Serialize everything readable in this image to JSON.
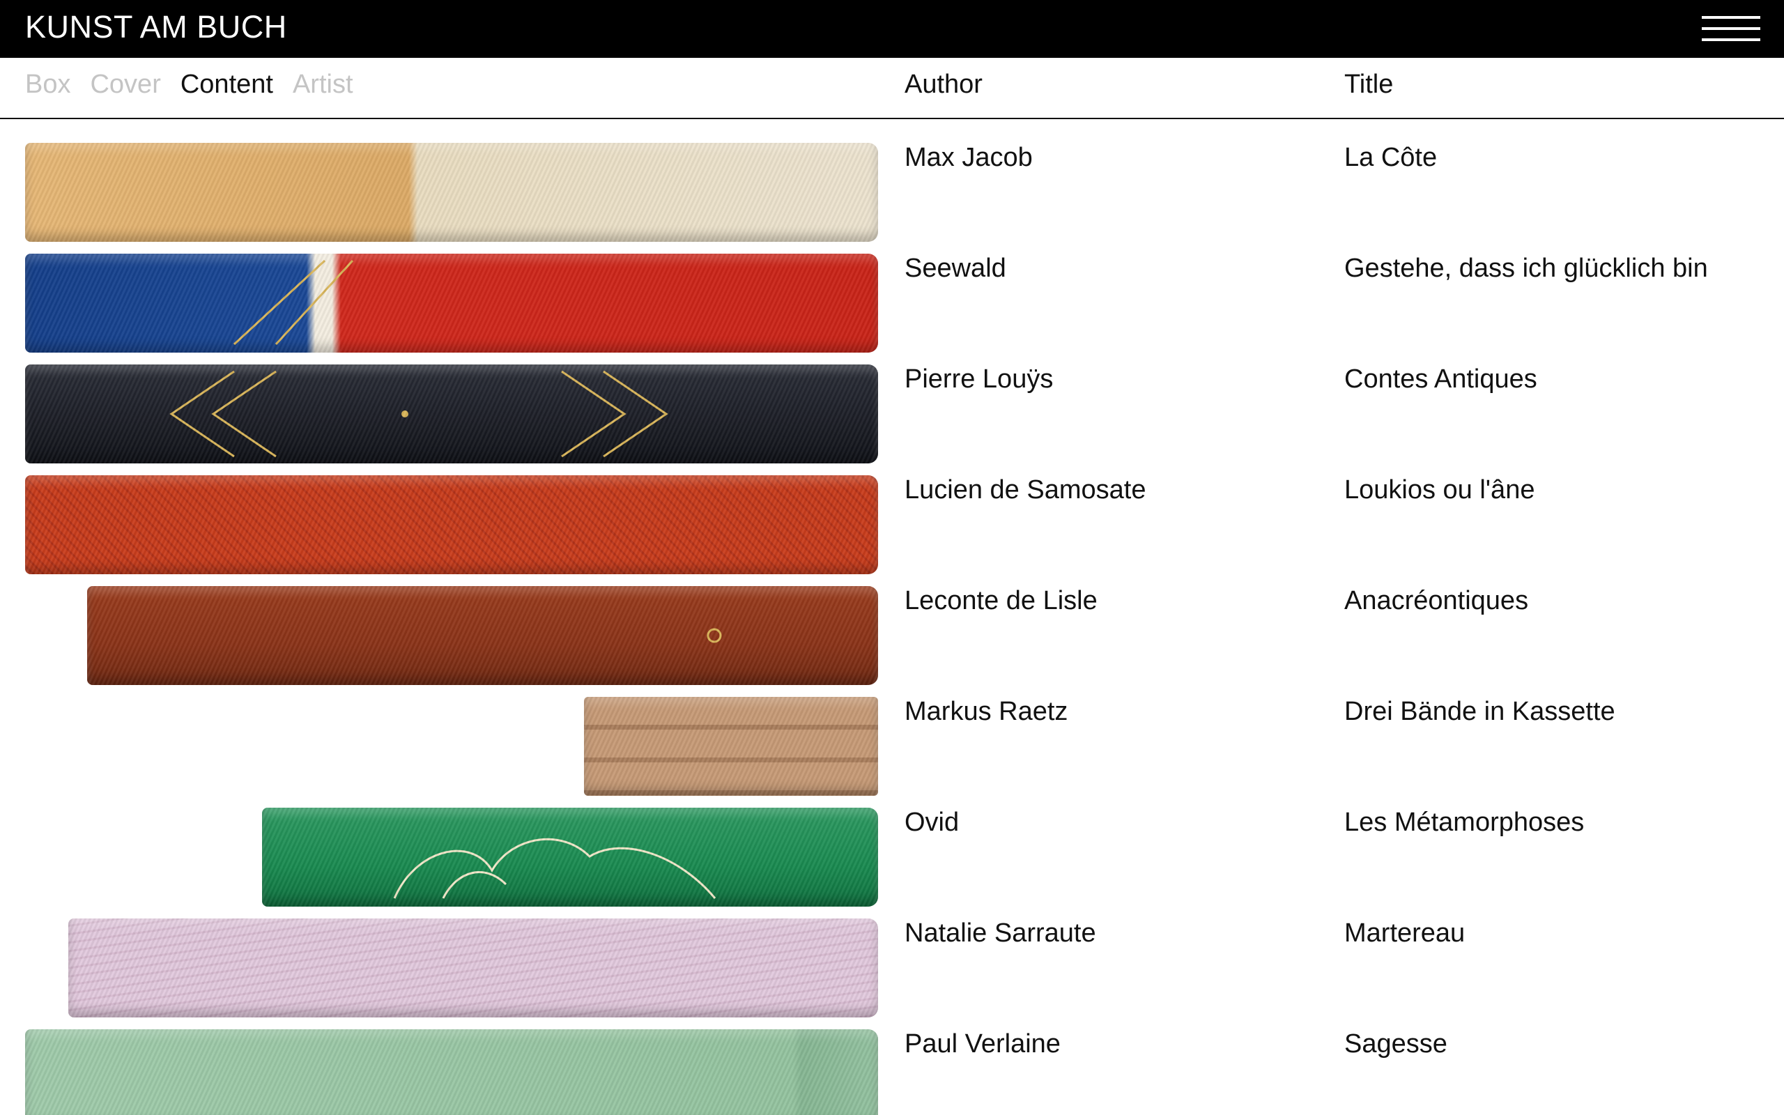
{
  "brand": "KUNST AM BUCH",
  "subnav": {
    "tabs": [
      {
        "label": "Box",
        "active": false
      },
      {
        "label": "Cover",
        "active": false
      },
      {
        "label": "Content",
        "active": true
      },
      {
        "label": "Artist",
        "active": false
      }
    ],
    "author_header": "Author",
    "title_header": "Title"
  },
  "books": [
    {
      "author": "Max Jacob",
      "title": "La Côte"
    },
    {
      "author": "Seewald",
      "title": "Gestehe, dass ich glücklich bin"
    },
    {
      "author": "Pierre Louÿs",
      "title": "Contes Antiques"
    },
    {
      "author": "Lucien de Samosate",
      "title": "Loukios ou l'âne"
    },
    {
      "author": "Leconte de Lisle",
      "title": "Anacréontiques"
    },
    {
      "author": "Markus Raetz",
      "title": "Drei Bände in Kassette"
    },
    {
      "author": "Ovid",
      "title": "Les Métamorphoses"
    },
    {
      "author": "Natalie Sarraute",
      "title": "Martereau"
    },
    {
      "author": "Paul Verlaine",
      "title": "Sagesse"
    }
  ],
  "icons": {
    "menu": "hamburger-menu-icon"
  }
}
